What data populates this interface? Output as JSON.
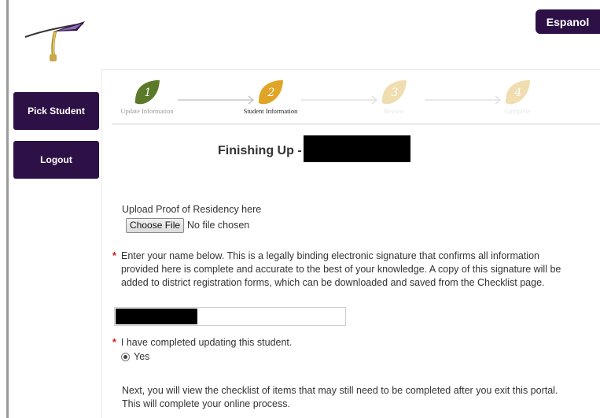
{
  "header": {
    "language_button": "Espanol"
  },
  "sidebar": {
    "pick_student": "Pick Student",
    "logout": "Logout"
  },
  "wizard": {
    "steps": [
      {
        "number": "1",
        "label": "Update Information",
        "state": "complete",
        "color": "#5a7a2a"
      },
      {
        "number": "2",
        "label": "Student Information",
        "state": "current",
        "color": "#e0a526"
      },
      {
        "number": "3",
        "label": "Review",
        "state": "upcoming",
        "color": "#f0ddb0"
      },
      {
        "number": "4",
        "label": "Complete",
        "state": "upcoming",
        "color": "#f0ddb0"
      }
    ]
  },
  "page": {
    "title": "Finishing Up -"
  },
  "form": {
    "upload_label": "Upload Proof of Residency here",
    "choose_file_button": "Choose File",
    "no_file_text": "No file chosen",
    "required_marker": "*",
    "signature_instructions": "Enter your name below. This is a legally binding electronic signature that confirms all information provided here is complete and accurate to the best of your knowledge. A copy of this signature will be added to district registration forms, which can be downloaded and saved from the Checklist page.",
    "completed_question": "I have completed updating this student.",
    "yes_option": "Yes",
    "yes_selected": true,
    "next_text": "Next, you will view the checklist of items that may still need to be completed after you exit this portal. This will complete your online process."
  },
  "colors": {
    "brand": "#2d1146",
    "required": "#d11111"
  }
}
